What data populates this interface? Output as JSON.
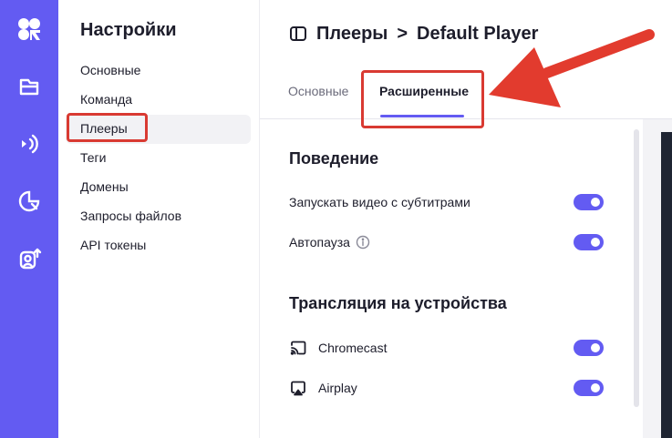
{
  "rail": {
    "items": [
      {
        "icon": "logo-icon"
      },
      {
        "icon": "folder-icon"
      },
      {
        "icon": "broadcast-icon"
      },
      {
        "icon": "analytics-icon"
      },
      {
        "icon": "upload-person-icon"
      }
    ],
    "background": "#635bf2"
  },
  "settings": {
    "title": "Настройки",
    "nav": [
      {
        "label": "Основные"
      },
      {
        "label": "Команда"
      },
      {
        "label": "Плееры",
        "active": true
      },
      {
        "label": "Теги"
      },
      {
        "label": "Домены"
      },
      {
        "label": "Запросы файлов"
      },
      {
        "label": "API токены"
      }
    ]
  },
  "header": {
    "breadcrumb_parent": "Плееры",
    "separator": ">",
    "breadcrumb_current": "Default Player"
  },
  "tabs": [
    {
      "label": "Основные",
      "active": false
    },
    {
      "label": "Расширенные",
      "active": true
    }
  ],
  "sections": {
    "behavior": {
      "title": "Поведение",
      "subtitles_label": "Запускать видео с субтитрами",
      "subtitles_on": true,
      "autopause_label": "Автопауза",
      "autopause_on": true
    },
    "casting": {
      "title": "Трансляция на устройства",
      "chromecast_label": "Chromecast",
      "chromecast_on": true,
      "airplay_label": "Airplay",
      "airplay_on": true
    }
  },
  "colors": {
    "accent": "#635bf2",
    "highlight": "#d93a32"
  }
}
